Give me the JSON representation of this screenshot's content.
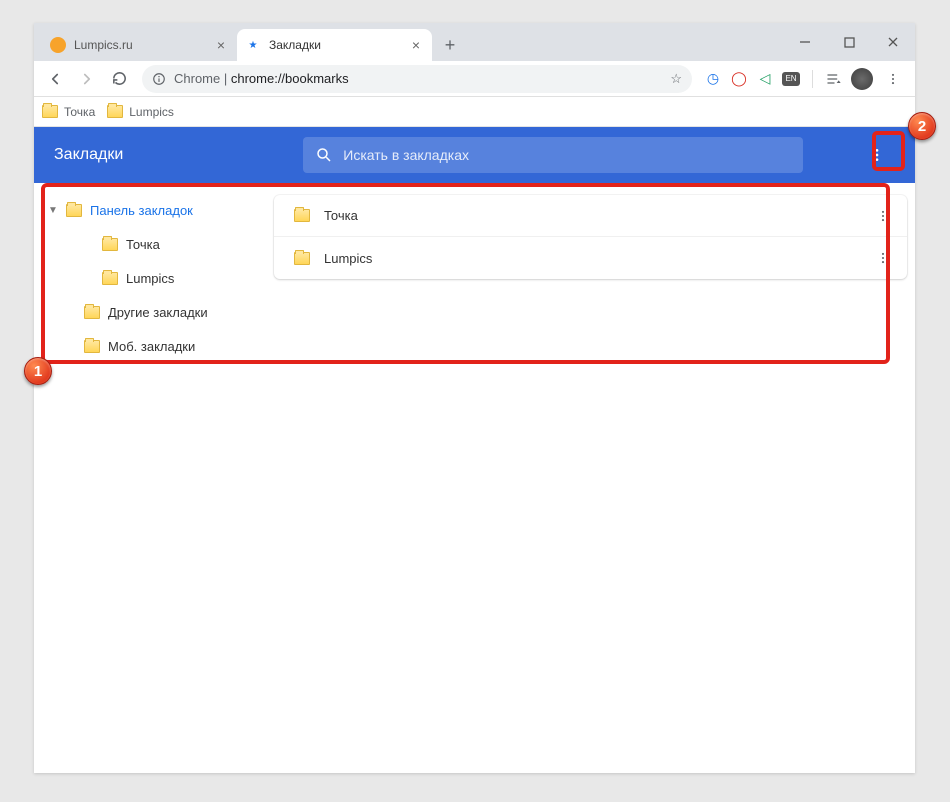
{
  "tabs": [
    {
      "title": "Lumpics.ru",
      "active": false
    },
    {
      "title": "Закладки",
      "active": true
    }
  ],
  "omnibox": {
    "host": "Chrome",
    "path": "chrome://bookmarks"
  },
  "bookmarks_bar": {
    "items": [
      {
        "label": "Точка"
      },
      {
        "label": "Lumpics"
      }
    ]
  },
  "header": {
    "title": "Закладки",
    "search_placeholder": "Искать в закладках"
  },
  "sidebar": {
    "root": {
      "label": "Панель закладок"
    },
    "children": [
      {
        "label": "Точка"
      },
      {
        "label": "Lumpics"
      }
    ],
    "other": {
      "label": "Другие закладки"
    },
    "mobile": {
      "label": "Моб. закладки"
    }
  },
  "list": {
    "items": [
      {
        "label": "Точка"
      },
      {
        "label": "Lumpics"
      }
    ]
  },
  "annotations": {
    "badge1": "1",
    "badge2": "2"
  }
}
